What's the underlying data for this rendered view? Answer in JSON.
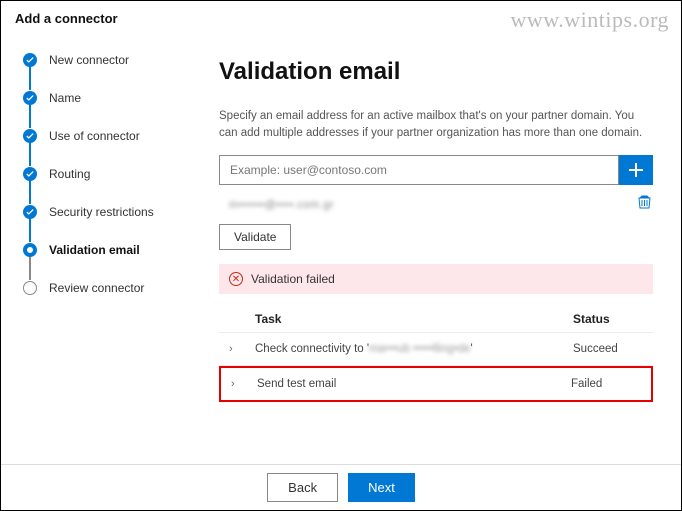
{
  "watermark": "www.wintips.org",
  "header": {
    "title": "Add a connector"
  },
  "sidebar": {
    "steps": [
      {
        "label": "New connector",
        "state": "done"
      },
      {
        "label": "Name",
        "state": "done"
      },
      {
        "label": "Use of connector",
        "state": "done"
      },
      {
        "label": "Routing",
        "state": "done"
      },
      {
        "label": "Security restrictions",
        "state": "done"
      },
      {
        "label": "Validation email",
        "state": "current"
      },
      {
        "label": "Review connector",
        "state": "pending"
      }
    ]
  },
  "main": {
    "title": "Validation email",
    "description": "Specify an email address for an active mailbox that's on your partner domain. You can add multiple addresses if your partner organization has more than one domain.",
    "email_placeholder": "Example: user@contoso.com",
    "added_email": "m••••••@••••.com.gr",
    "validate_label": "Validate",
    "alert_text": "Validation failed",
    "table": {
      "task_header": "Task",
      "status_header": "Status",
      "rows": [
        {
          "task_prefix": "Check connectivity to '",
          "task_blur": "ma•••ub •••••lling•de",
          "task_suffix": "'",
          "status": "Succeed",
          "highlight": false
        },
        {
          "task_prefix": "Send test email",
          "task_blur": "",
          "task_suffix": "",
          "status": "Failed",
          "highlight": true
        }
      ]
    }
  },
  "footer": {
    "back_label": "Back",
    "next_label": "Next"
  }
}
